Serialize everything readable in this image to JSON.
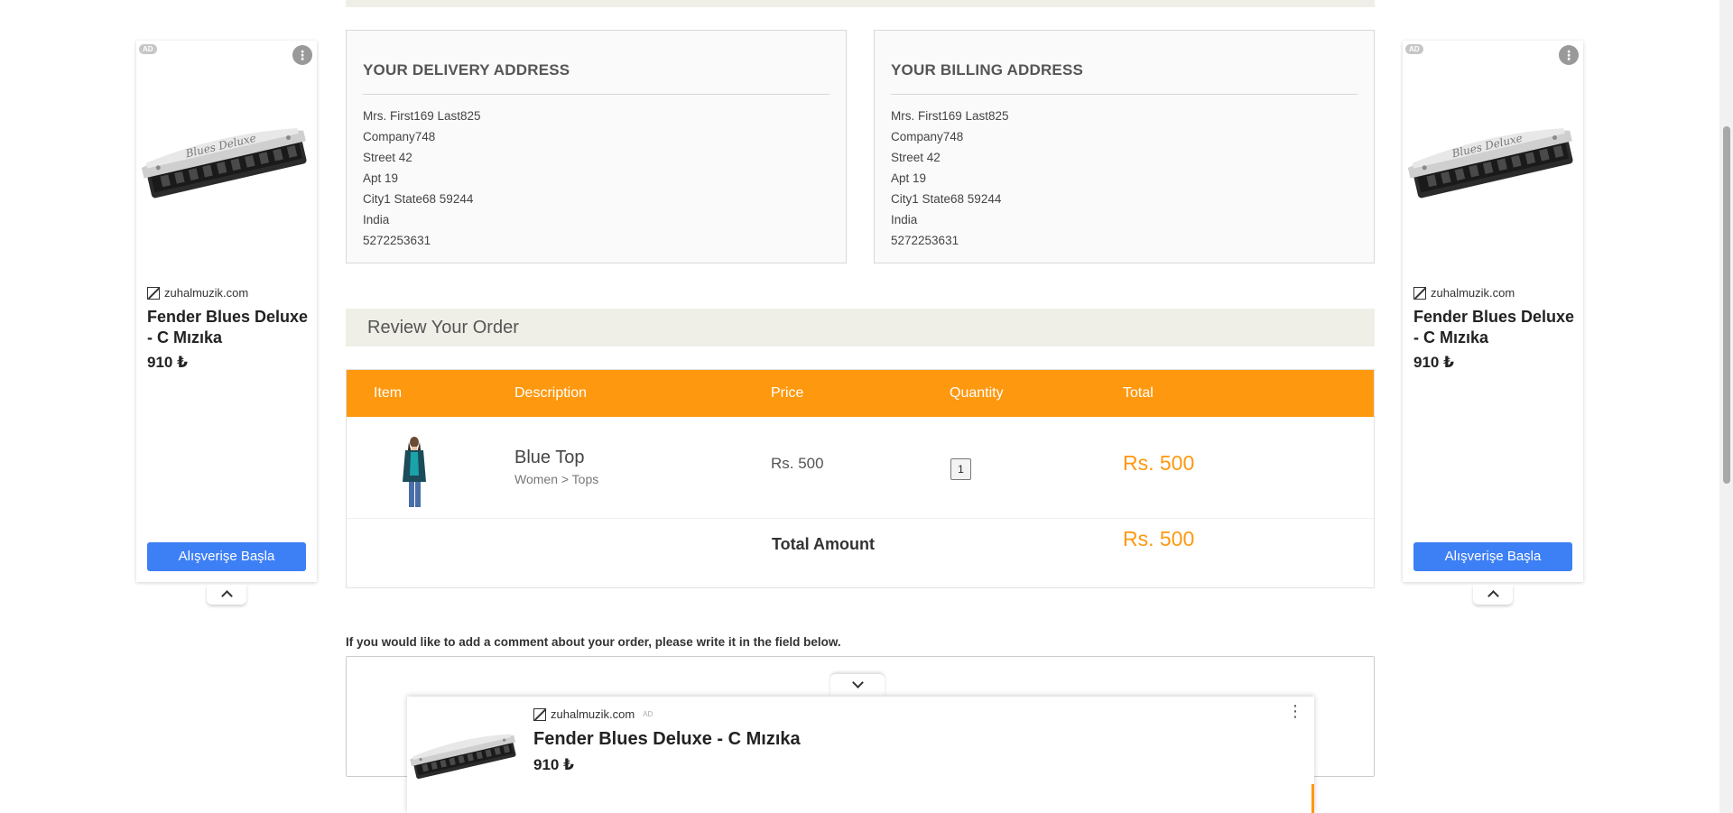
{
  "delivery": {
    "title": "YOUR DELIVERY ADDRESS",
    "lines": [
      "Mrs. First169 Last825",
      "Company748",
      "Street 42",
      "Apt 19",
      "City1 State68 59244",
      "India",
      "5272253631"
    ]
  },
  "billing": {
    "title": "YOUR BILLING ADDRESS",
    "lines": [
      "Mrs. First169 Last825",
      "Company748",
      "Street 42",
      "Apt 19",
      "City1 State68 59244",
      "India",
      "5272253631"
    ]
  },
  "review": {
    "heading": "Review Your Order",
    "columns": [
      "Item",
      "Description",
      "Price",
      "Quantity",
      "Total"
    ],
    "item": {
      "name": "Blue Top",
      "category": "Women > Tops",
      "price": "Rs. 500",
      "quantity": "1",
      "total": "Rs. 500"
    },
    "total_label": "Total Amount",
    "total_value": "Rs. 500"
  },
  "comment": {
    "label": "If you would like to add a comment about your order, please write it in the field below.",
    "value": ""
  },
  "ads": {
    "badge": "AD",
    "menu_icon": "⋮",
    "domain": "zuhalmuzik.com",
    "title": "Fender Blues Deluxe - C Mızıka",
    "price": "910 ₺",
    "cta": "Alışverişe Başla"
  },
  "colors": {
    "accent": "#fe980f",
    "header_bg": "#efefe8",
    "cta": "#3d7ff5"
  }
}
